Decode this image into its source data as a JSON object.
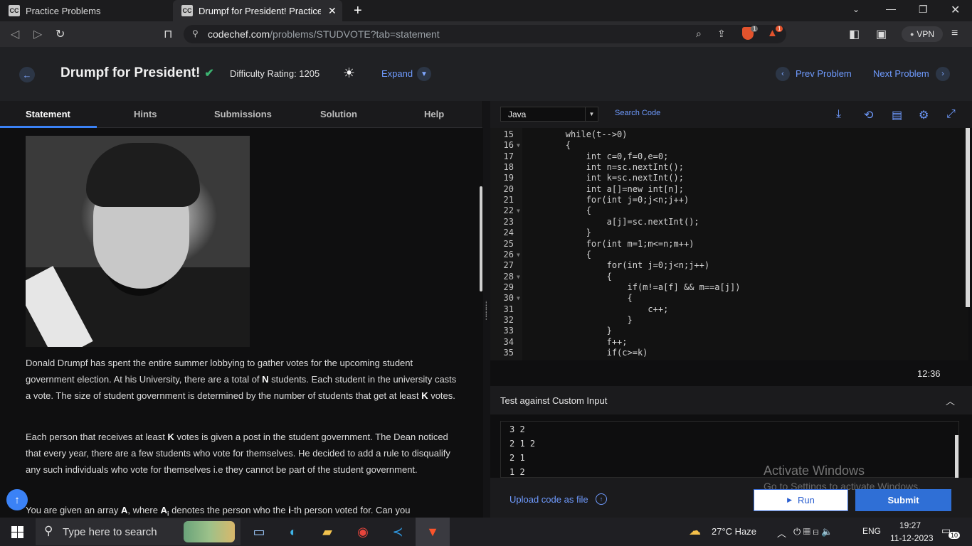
{
  "browser": {
    "tabs": [
      {
        "favicon": "CC",
        "label": "Practice Problems"
      },
      {
        "favicon": "CC",
        "label": "Drumpf for President! Practice C"
      }
    ],
    "url_host": "codechef.com",
    "url_path": "/problems/STUDVOTE?tab=statement",
    "vpn_label": "VPN",
    "brave_badge": "1",
    "alert_badge": "1"
  },
  "header": {
    "title": "Drumpf for President!",
    "difficulty": "Difficulty Rating: 1205",
    "expand": "Expand",
    "prev": "Prev Problem",
    "next": "Next Problem"
  },
  "left_tabs": [
    "Statement",
    "Hints",
    "Submissions",
    "Solution",
    "Help"
  ],
  "statement": {
    "para1_a": "Donald Drumpf has spent the entire summer lobbying to gather votes for the upcoming student government election. At his University, there are a total of ",
    "para1_N": "N",
    "para1_b": " students. Each student in the university casts a vote. The size of student government is determined by the number of students that get at least ",
    "para1_K": "K",
    "para1_c": " votes.",
    "para2_a": "Each person that receives at least ",
    "para2_K": "K",
    "para2_b": " votes is given a post in the student government. The Dean noticed that every year, there are a few students who vote for themselves. He decided to add a rule to disqualify any such individuals who vote for themselves i.e they cannot be part of the student government.",
    "para3_a": "You are given an array ",
    "para3_A": "A",
    "para3_b": ", where ",
    "para3_Ai": "A",
    "para3_i": "i",
    "para3_c": " denotes the person who the ",
    "para3_ith": "i",
    "para3_d": "-th person voted for. Can you"
  },
  "editor": {
    "language": "Java",
    "search_code": "Search Code",
    "lines": [
      {
        "n": "15",
        "fold": false,
        "text": "        while(t-->0)"
      },
      {
        "n": "16",
        "fold": true,
        "text": "        {"
      },
      {
        "n": "17",
        "fold": false,
        "text": "            int c=0,f=0,e=0;"
      },
      {
        "n": "18",
        "fold": false,
        "text": "            int n=sc.nextInt();"
      },
      {
        "n": "19",
        "fold": false,
        "text": "            int k=sc.nextInt();"
      },
      {
        "n": "20",
        "fold": false,
        "text": "            int a[]=new int[n];"
      },
      {
        "n": "21",
        "fold": false,
        "text": "            for(int j=0;j<n;j++)"
      },
      {
        "n": "22",
        "fold": true,
        "text": "            {"
      },
      {
        "n": "23",
        "fold": false,
        "text": "                a[j]=sc.nextInt();"
      },
      {
        "n": "24",
        "fold": false,
        "text": "            }"
      },
      {
        "n": "25",
        "fold": false,
        "text": "            for(int m=1;m<=n;m++)"
      },
      {
        "n": "26",
        "fold": true,
        "text": "            {"
      },
      {
        "n": "27",
        "fold": false,
        "text": "                for(int j=0;j<n;j++)"
      },
      {
        "n": "28",
        "fold": true,
        "text": "                {"
      },
      {
        "n": "29",
        "fold": false,
        "text": "                    if(m!=a[f] && m==a[j])"
      },
      {
        "n": "30",
        "fold": true,
        "text": "                    {"
      },
      {
        "n": "31",
        "fold": false,
        "text": "                        c++;"
      },
      {
        "n": "32",
        "fold": false,
        "text": "                    }"
      },
      {
        "n": "33",
        "fold": false,
        "text": "                }"
      },
      {
        "n": "34",
        "fold": false,
        "text": "                f++;"
      },
      {
        "n": "35",
        "fold": false,
        "text": "                if(c>=k)"
      }
    ],
    "timer": "12:36"
  },
  "custom": {
    "title": "Test against Custom Input",
    "lines": [
      "3 2",
      "2 1 2",
      "2 1",
      "1 2"
    ],
    "upload": "Upload code as file",
    "run": "Run",
    "submit": "Submit"
  },
  "watermark": {
    "line1": "Activate Windows",
    "line2": "Go to Settings to activate Windows."
  },
  "taskbar": {
    "search_placeholder": "Type here to search",
    "weather": "27°C  Haze",
    "lang": "ENG",
    "time": "19:27",
    "date": "11-12-2023",
    "notif_count": "10"
  }
}
